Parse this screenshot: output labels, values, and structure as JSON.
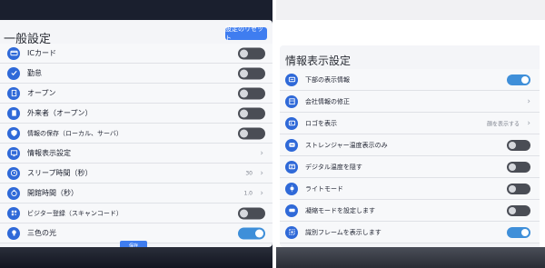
{
  "left": {
    "title": "一般設定",
    "reset_label": "設定のリセット",
    "rows": [
      {
        "label": "ICカード",
        "icon": "card-icon",
        "control": "toggle",
        "on": false
      },
      {
        "label": "勤怠",
        "icon": "check-icon",
        "control": "toggle",
        "on": false
      },
      {
        "label": "オープン",
        "icon": "door-icon",
        "control": "toggle",
        "on": false
      },
      {
        "label": "外来者（オープン）",
        "icon": "document-icon",
        "control": "toggle",
        "on": false
      },
      {
        "label": "情報の保存（ローカル、サーバ）",
        "icon": "shield-icon",
        "control": "toggle",
        "on": false
      },
      {
        "label": "情報表示設定",
        "icon": "display-icon",
        "control": "chevron"
      },
      {
        "label": "スリープ時間（秒）",
        "icon": "clock-icon",
        "control": "value",
        "value": "30"
      },
      {
        "label": "開館時間（秒）",
        "icon": "timer-icon",
        "control": "value",
        "value": "1.0"
      },
      {
        "label": "ビジター登録（スキャンコード）",
        "icon": "qr-icon",
        "control": "toggle",
        "on": false
      },
      {
        "label": "三色の光",
        "icon": "bulb-icon",
        "control": "toggle",
        "on": true
      }
    ],
    "save_label": "保存"
  },
  "right": {
    "title": "情報表示設定",
    "rows": [
      {
        "label": "下部の表示情報",
        "icon": "info-icon",
        "control": "toggle",
        "on": true
      },
      {
        "label": "会社情報の修正",
        "icon": "building-icon",
        "control": "chevron"
      },
      {
        "label": "ロゴを表示",
        "icon": "logo-icon",
        "control": "value",
        "value": "顔を表示する"
      },
      {
        "label": "ストレンジャー温度表示のみ",
        "icon": "thermometer-icon",
        "control": "toggle",
        "on": false
      },
      {
        "label": "デジタル温度を隠す",
        "icon": "digital-icon",
        "control": "toggle",
        "on": false
      },
      {
        "label": "ライトモード",
        "icon": "light-icon",
        "control": "toggle",
        "on": false
      },
      {
        "label": "凝縮モードを設定します",
        "icon": "compact-icon",
        "control": "toggle",
        "on": false
      },
      {
        "label": "識別フレームを表示します",
        "icon": "frame-icon",
        "control": "toggle",
        "on": true
      }
    ]
  },
  "colors": {
    "accent": "#3f7df0",
    "toggle_on": "#3f8fd9",
    "toggle_off": "#4a4d55",
    "icon": "#2f69d8"
  }
}
